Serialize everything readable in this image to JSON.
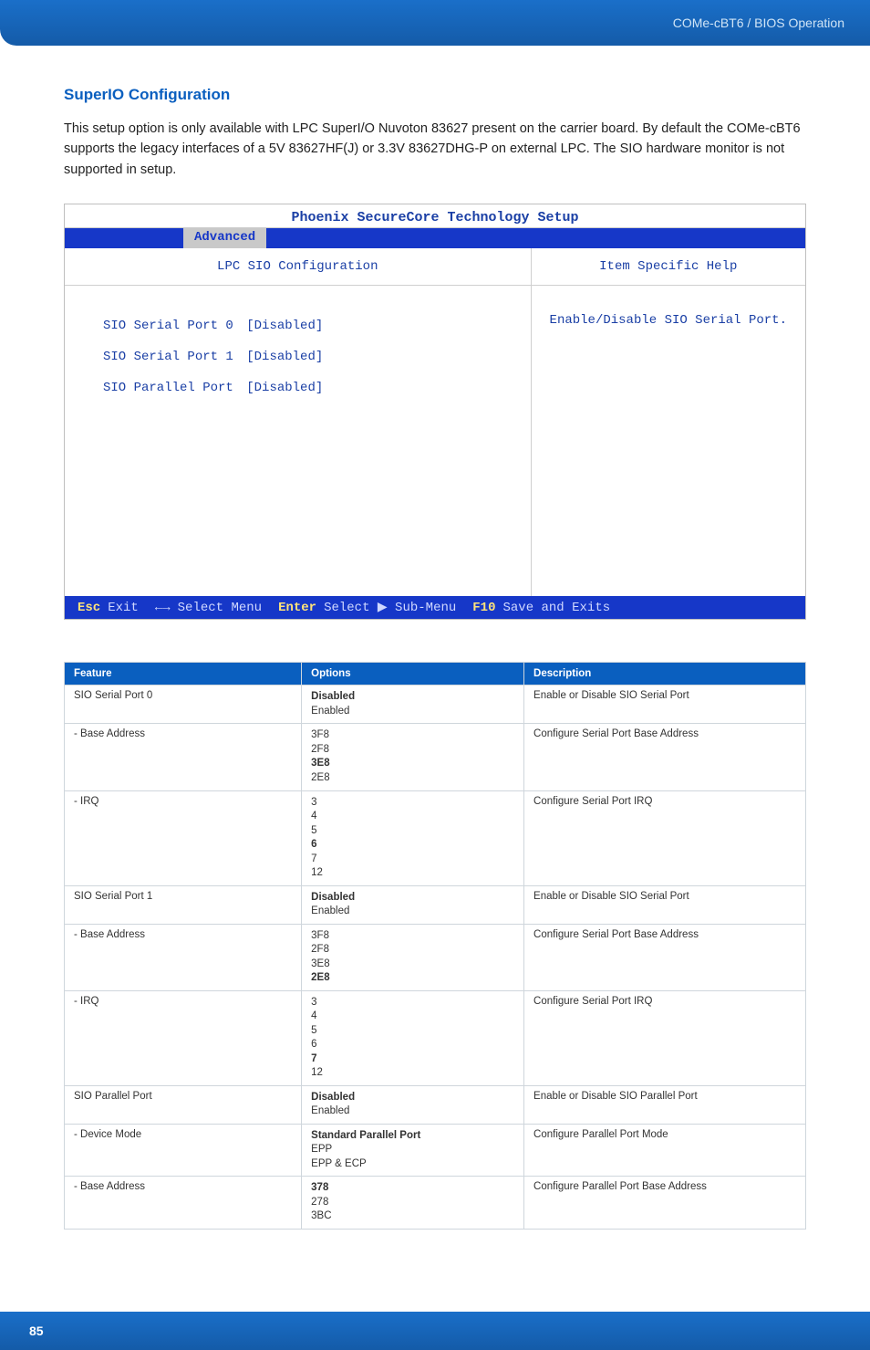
{
  "header": {
    "breadcrumb": "COMe-cBT6 / BIOS Operation"
  },
  "section": {
    "title": "SuperIO Configuration",
    "intro": "This setup option is only available with LPC SuperI/O Nuvoton 83627 present on the carrier board. By default the COMe-cBT6 supports the legacy interfaces of a 5V 83627HF(J) or 3.3V 83627DHG-P on external LPC. The SIO hardware monitor is not supported in setup."
  },
  "bios": {
    "title": "Phoenix SecureCore Technology Setup",
    "tab": "Advanced",
    "left_title": "LPC SIO Configuration",
    "right_title": "Item Specific Help",
    "options": [
      {
        "label": "SIO Serial Port 0",
        "value": "[Disabled]"
      },
      {
        "label": "SIO Serial Port 1",
        "value": "[Disabled]"
      },
      {
        "label": "SIO Parallel Port",
        "value": "[Disabled]"
      }
    ],
    "help_text": "Enable/Disable SIO Serial Port.",
    "footer": {
      "k1": "Esc",
      "a1": "Exit",
      "arrows": "←→",
      "a2": "Select Menu",
      "k2": "Enter",
      "a3": "Select ▶ Sub-Menu",
      "k3": "F10",
      "a4": "Save and Exits"
    }
  },
  "table": {
    "headers": {
      "feature": "Feature",
      "options": "Options",
      "description": "Description"
    },
    "rows": [
      {
        "feature": "SIO Serial Port 0",
        "options": [
          {
            "t": "Disabled",
            "b": true
          },
          {
            "t": "Enabled"
          }
        ],
        "desc": "Enable or Disable SIO Serial Port"
      },
      {
        "feature": "- Base Address",
        "options": [
          {
            "t": "3F8"
          },
          {
            "t": "2F8"
          },
          {
            "t": "3E8",
            "b": true
          },
          {
            "t": "2E8"
          }
        ],
        "desc": "Configure Serial Port Base Address"
      },
      {
        "feature": "- IRQ",
        "options": [
          {
            "t": "3"
          },
          {
            "t": "4"
          },
          {
            "t": "5"
          },
          {
            "t": "6",
            "b": true
          },
          {
            "t": "7"
          },
          {
            "t": "12"
          }
        ],
        "desc": "Configure Serial Port IRQ"
      },
      {
        "feature": "SIO Serial Port 1",
        "options": [
          {
            "t": "Disabled",
            "b": true
          },
          {
            "t": "Enabled"
          }
        ],
        "desc": "Enable or Disable SIO Serial Port"
      },
      {
        "feature": "- Base Address",
        "options": [
          {
            "t": "3F8"
          },
          {
            "t": "2F8"
          },
          {
            "t": "3E8"
          },
          {
            "t": "2E8",
            "b": true
          }
        ],
        "desc": "Configure Serial Port Base Address"
      },
      {
        "feature": "- IRQ",
        "options": [
          {
            "t": "3"
          },
          {
            "t": "4"
          },
          {
            "t": "5"
          },
          {
            "t": "6"
          },
          {
            "t": "7",
            "b": true
          },
          {
            "t": "12"
          }
        ],
        "desc": "Configure Serial Port IRQ"
      },
      {
        "feature": "SIO Parallel Port",
        "options": [
          {
            "t": "Disabled",
            "b": true
          },
          {
            "t": "Enabled"
          }
        ],
        "desc": "Enable or Disable SIO Parallel Port"
      },
      {
        "feature": "- Device Mode",
        "options": [
          {
            "t": "Standard Parallel Port",
            "b": true
          },
          {
            "t": "EPP"
          },
          {
            "t": "EPP & ECP"
          }
        ],
        "desc": "Configure Parallel Port Mode"
      },
      {
        "feature": "- Base Address",
        "options": [
          {
            "t": "378",
            "b": true
          },
          {
            "t": "278"
          },
          {
            "t": "3BC"
          }
        ],
        "desc": "Configure Parallel Port Base Address"
      }
    ]
  },
  "footer": {
    "page": "85"
  }
}
